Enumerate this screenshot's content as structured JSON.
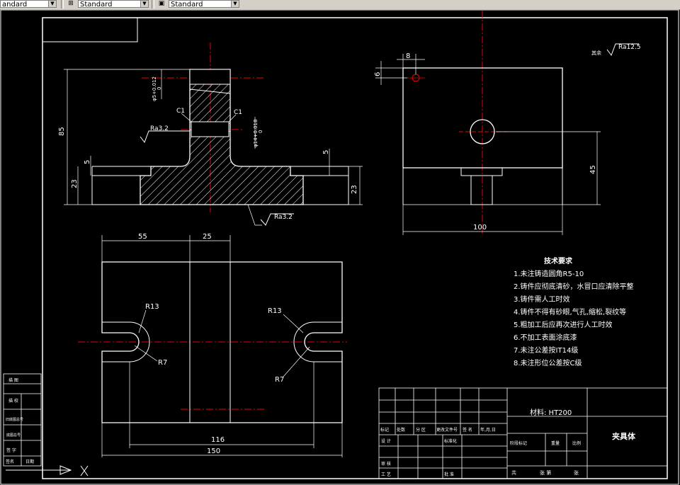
{
  "toolbar": {
    "dimstyle_value": "Standard",
    "dimstyle_icon": "dimension-style-icon",
    "textstyle_value": "Standard",
    "textstyle_icon": "text-style-icon",
    "left_value": "andard"
  },
  "drawing": {
    "roughness_top_right": "Ra12.5",
    "roughness_top_right_prefix": "其余",
    "front_view": {
      "dim_height_85": "85",
      "dim_5_left": "5",
      "dim_23_left": "23",
      "dim_5_right": "5",
      "dim_23_right": "23",
      "hole_tol_top": "φ5+0.012",
      "hole_tol_top_b": "0",
      "hole_tol_mid": "φ14+0.018",
      "hole_tol_mid_b": "0",
      "chamfer_left": "C1",
      "chamfer_right": "C1",
      "rough_left": "Ra3.2",
      "rough_bottom": "Ra3.2"
    },
    "side_view": {
      "dim_8": "8",
      "dim_6": "6",
      "dim_45": "45",
      "dim_100": "100"
    },
    "top_view": {
      "dim_55": "55",
      "dim_25": "25",
      "r13_left": "R13",
      "r7_left": "R7",
      "r13_right": "R13",
      "r7_right": "R7",
      "dim_116": "116",
      "dim_150": "150"
    },
    "tech_req": {
      "title": "技术要求",
      "items": [
        "1.未注铸造圆角R5-10",
        "2.铸件应彻底清砂，水冒口应清除平整",
        "3.铸件需人工时效",
        "4.铸件不得有砂眼,气孔,缩松,裂纹等",
        "5.粗加工后应再次进行人工时效",
        "6.不加工表面涂底漆",
        "7.未注公差按IT14级",
        "8.未注形位公差按C级"
      ]
    },
    "title_block": {
      "material": "材料: HT200",
      "part_name": "夹具体",
      "row_labels": [
        "标记",
        "处数",
        "分 区",
        "更改文件号",
        "签 名",
        "年,月,日"
      ],
      "design": "设 计",
      "standardize": "标准化",
      "review": "审 核",
      "process": "工 艺",
      "approve": "批 准",
      "stage_mark": "阶段标记",
      "weight": "重量",
      "scale": "比例",
      "sheets": "共",
      "sheet_of": "张 第",
      "sheet_unit": "张"
    },
    "left_block": {
      "labels": [
        "描 图",
        "描 校",
        "旧底图总号",
        "底图总号",
        "签 字",
        "签名",
        "日期"
      ]
    }
  }
}
